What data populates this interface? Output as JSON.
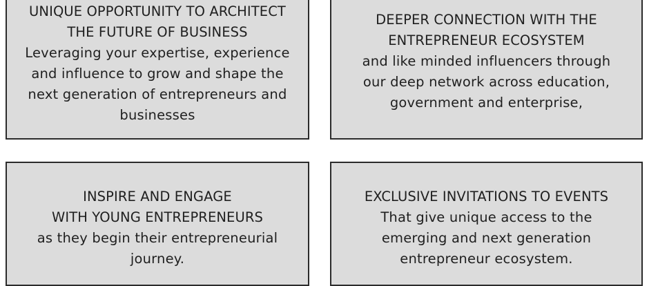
{
  "cards": [
    {
      "heading": [
        "UNIQUE OPPORTUNITY TO ARCHITECT",
        "THE FUTURE OF BUSINESS"
      ],
      "body": [
        "Leveraging your expertise, experience",
        "and influence to grow and shape the",
        "next generation of entrepreneurs and",
        "businesses"
      ]
    },
    {
      "heading": [
        "DEEPER CONNECTION WITH THE",
        "ENTREPRENEUR ECOSYSTEM"
      ],
      "body": [
        "and like minded influencers through",
        "our deep network across education,",
        "government and enterprise,"
      ]
    },
    {
      "heading": [
        "INSPIRE AND ENGAGE",
        "WITH YOUNG ENTREPRENEURS"
      ],
      "body": [
        "as they begin their entrepreneurial",
        "journey."
      ]
    },
    {
      "heading": [
        "EXCLUSIVE INVITATIONS TO EVENTS"
      ],
      "body": [
        "That give unique access to the",
        "emerging and next generation",
        "entrepreneur ecosystem."
      ]
    }
  ],
  "colors": {
    "card_background": "#dcdcdc",
    "card_border": "#2b2b2b",
    "text": "#1f1f1f"
  }
}
